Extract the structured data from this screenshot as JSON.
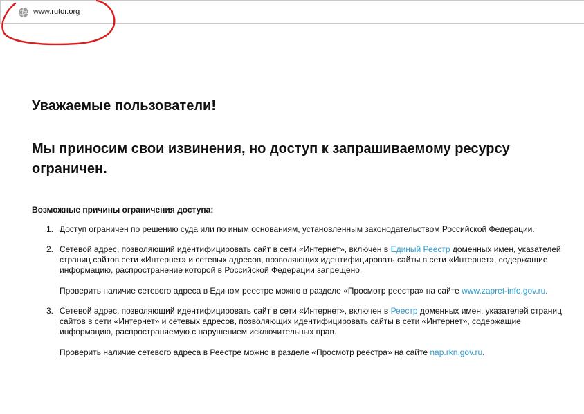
{
  "browser": {
    "url_prefix": "www.",
    "url_domain": "rutor.org",
    "globe_icon": "globe-icon",
    "annotation_color": "#d81f1f"
  },
  "page": {
    "greeting": "Уважаемые пользователи!",
    "apology": "Мы приносим свои извинения, но доступ к запрашиваемому ресурсу ограничен.",
    "reasons_title": "Возможные причины ограничения доступа:",
    "link_color": "#2a9ccc",
    "reasons": [
      {
        "num": "1.",
        "text": "Доступ ограничен  по решению суда или по иным основаниям, установленным законодательством Российской Федерации."
      },
      {
        "num": "2.",
        "text_before": "Сетевой адрес, позволяющий идентифицировать сайт в сети «Интернет», включен в ",
        "link": "Единый Реестр",
        "text_after": " доменных имен, указателей страниц сайтов сети «Интернет» и сетевых адресов, позволяющих идентифицировать сайты в сети «Интернет», содержащие информацию, распространение которой в Российской Федерации запрещено.",
        "note_before": "Проверить наличие сетевого адреса в Едином реестре можно в разделе «Просмотр реестра» на сайте ",
        "note_link": "www.zapret-info.gov.ru",
        "note_after": "."
      },
      {
        "num": "3.",
        "text_before": "Сетевой адрес, позволяющий идентифицировать сайт в сети «Интернет», включен в ",
        "link": "Реестр",
        "text_after": " доменных имен, указателей страниц сайтов в сети «Интернет» и сетевых адресов, позволяющих идентифицировать сайты в сети «Интернет», содержащие информацию, распространяемую с нарушением исключительных прав.",
        "note_before": "Проверить наличие сетевого адреса в Реестре можно в разделе «Просмотр реестра» на сайте ",
        "note_link": "nap.rkn.gov.ru",
        "note_after": "."
      }
    ]
  }
}
